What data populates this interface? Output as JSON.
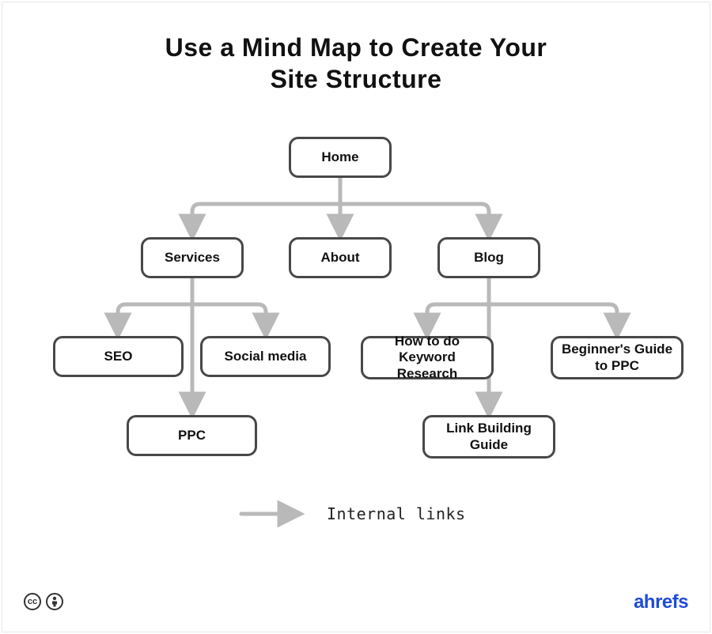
{
  "title_line1": "Use a Mind Map to Create Your",
  "title_line2": "Site Structure",
  "nodes": {
    "home": "Home",
    "services": "Services",
    "about": "About",
    "blog": "Blog",
    "seo": "SEO",
    "social": "Social media",
    "ppc": "PPC",
    "kw": "How to do Keyword Research",
    "bg": "Beginner's Guide to PPC",
    "lb": "Link Building Guide"
  },
  "legend": "Internal links",
  "cc_label": "cc",
  "brand_a": "ahrefs"
}
